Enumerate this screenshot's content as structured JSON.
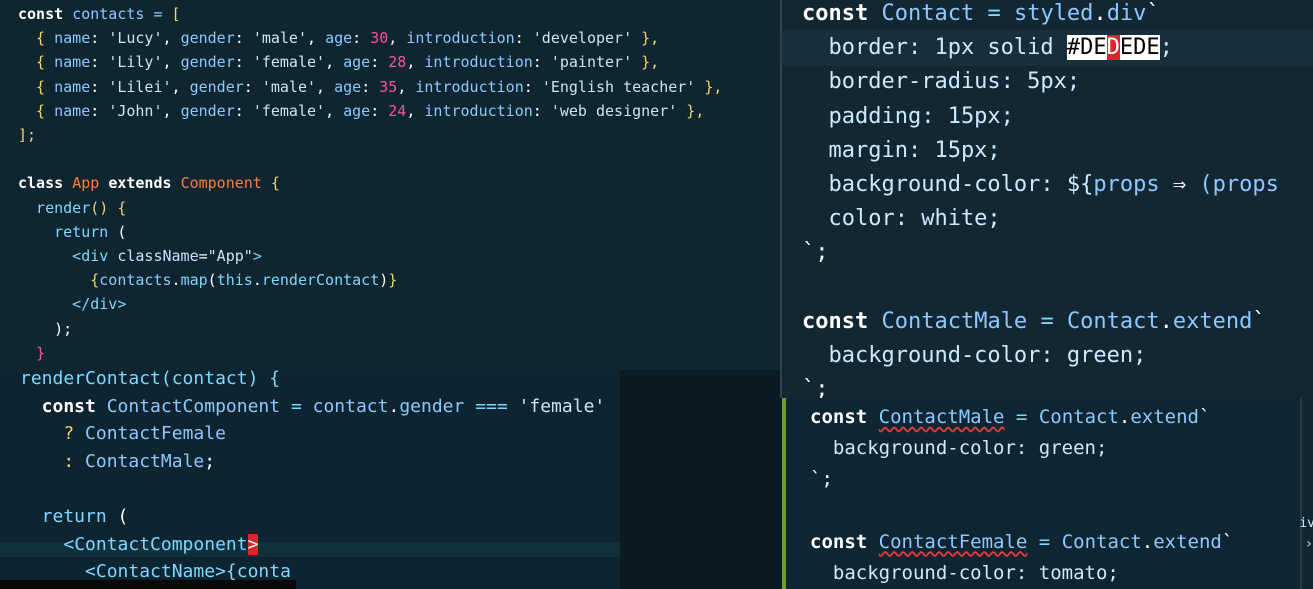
{
  "panel_a": {
    "lines": [
      [
        {
          "t": "const ",
          "c": "kw"
        },
        {
          "t": "contacts",
          "c": "ident"
        },
        {
          "t": " = ",
          "c": "op"
        },
        {
          "t": "[",
          "c": "punc"
        }
      ],
      [
        {
          "t": "  { ",
          "c": "punc"
        },
        {
          "t": "name",
          "c": "ident"
        },
        {
          "t": ": ",
          "c": "plain"
        },
        {
          "t": "'Lucy'",
          "c": "str"
        },
        {
          "t": ", ",
          "c": "plain"
        },
        {
          "t": "gender",
          "c": "ident"
        },
        {
          "t": ": ",
          "c": "plain"
        },
        {
          "t": "'male'",
          "c": "str"
        },
        {
          "t": ", ",
          "c": "plain"
        },
        {
          "t": "age",
          "c": "ident"
        },
        {
          "t": ": ",
          "c": "plain"
        },
        {
          "t": "30",
          "c": "num"
        },
        {
          "t": ", ",
          "c": "plain"
        },
        {
          "t": "introduction",
          "c": "ident"
        },
        {
          "t": ": ",
          "c": "plain"
        },
        {
          "t": "'developer'",
          "c": "str"
        },
        {
          "t": " },",
          "c": "punc"
        }
      ],
      [
        {
          "t": "  { ",
          "c": "punc"
        },
        {
          "t": "name",
          "c": "ident"
        },
        {
          "t": ": ",
          "c": "plain"
        },
        {
          "t": "'Lily'",
          "c": "str"
        },
        {
          "t": ", ",
          "c": "plain"
        },
        {
          "t": "gender",
          "c": "ident"
        },
        {
          "t": ": ",
          "c": "plain"
        },
        {
          "t": "'female'",
          "c": "str"
        },
        {
          "t": ", ",
          "c": "plain"
        },
        {
          "t": "age",
          "c": "ident"
        },
        {
          "t": ": ",
          "c": "plain"
        },
        {
          "t": "28",
          "c": "num"
        },
        {
          "t": ", ",
          "c": "plain"
        },
        {
          "t": "introduction",
          "c": "ident"
        },
        {
          "t": ": ",
          "c": "plain"
        },
        {
          "t": "'painter'",
          "c": "str"
        },
        {
          "t": " },",
          "c": "punc"
        }
      ],
      [
        {
          "t": "  { ",
          "c": "punc"
        },
        {
          "t": "name",
          "c": "ident"
        },
        {
          "t": ": ",
          "c": "plain"
        },
        {
          "t": "'Lilei'",
          "c": "str"
        },
        {
          "t": ", ",
          "c": "plain"
        },
        {
          "t": "gender",
          "c": "ident"
        },
        {
          "t": ": ",
          "c": "plain"
        },
        {
          "t": "'male'",
          "c": "str"
        },
        {
          "t": ", ",
          "c": "plain"
        },
        {
          "t": "age",
          "c": "ident"
        },
        {
          "t": ": ",
          "c": "plain"
        },
        {
          "t": "35",
          "c": "num"
        },
        {
          "t": ", ",
          "c": "plain"
        },
        {
          "t": "introduction",
          "c": "ident"
        },
        {
          "t": ": ",
          "c": "plain"
        },
        {
          "t": "'English teacher'",
          "c": "str"
        },
        {
          "t": " },",
          "c": "punc"
        }
      ],
      [
        {
          "t": "  { ",
          "c": "punc"
        },
        {
          "t": "name",
          "c": "ident"
        },
        {
          "t": ": ",
          "c": "plain"
        },
        {
          "t": "'John'",
          "c": "str"
        },
        {
          "t": ", ",
          "c": "plain"
        },
        {
          "t": "gender",
          "c": "ident"
        },
        {
          "t": ": ",
          "c": "plain"
        },
        {
          "t": "'female'",
          "c": "str"
        },
        {
          "t": ", ",
          "c": "plain"
        },
        {
          "t": "age",
          "c": "ident"
        },
        {
          "t": ": ",
          "c": "plain"
        },
        {
          "t": "24",
          "c": "num"
        },
        {
          "t": ", ",
          "c": "plain"
        },
        {
          "t": "introduction",
          "c": "ident"
        },
        {
          "t": ": ",
          "c": "plain"
        },
        {
          "t": "'web designer'",
          "c": "str"
        },
        {
          "t": " },",
          "c": "punc"
        }
      ],
      [
        {
          "t": "];",
          "c": "punc"
        }
      ],
      [],
      [
        {
          "t": "class ",
          "c": "kw"
        },
        {
          "t": "App ",
          "c": "cls"
        },
        {
          "t": "extends ",
          "c": "kw"
        },
        {
          "t": "Component ",
          "c": "cls"
        },
        {
          "t": "{",
          "c": "punc"
        }
      ],
      [
        {
          "t": "  render",
          "c": "ml"
        },
        {
          "t": "() ",
          "c": "punc"
        },
        {
          "t": "{",
          "c": "punc"
        }
      ],
      [
        {
          "t": "    return ",
          "c": "ml"
        },
        {
          "t": "(",
          "c": "plain"
        }
      ],
      [
        {
          "t": "      <",
          "c": "tag"
        },
        {
          "t": "div ",
          "c": "tag"
        },
        {
          "t": "className",
          "c": "attr"
        },
        {
          "t": "=",
          "c": "plain"
        },
        {
          "t": "\"App\"",
          "c": "str"
        },
        {
          "t": ">",
          "c": "tag"
        }
      ],
      [
        {
          "t": "        {",
          "c": "punc"
        },
        {
          "t": "contacts",
          "c": "ident"
        },
        {
          "t": ".",
          "c": "plain"
        },
        {
          "t": "map",
          "c": "ml"
        },
        {
          "t": "(",
          "c": "plain"
        },
        {
          "t": "this",
          "c": "ml"
        },
        {
          "t": ".",
          "c": "plain"
        },
        {
          "t": "renderContact",
          "c": "ml"
        },
        {
          "t": ")",
          "c": "plain"
        },
        {
          "t": "}",
          "c": "punc"
        }
      ],
      [
        {
          "t": "      </",
          "c": "tag"
        },
        {
          "t": "div",
          "c": "tag"
        },
        {
          "t": ">",
          "c": "tag"
        }
      ],
      [
        {
          "t": "    );",
          "c": "plain"
        }
      ],
      [
        {
          "t": "  }",
          "c": "num"
        }
      ]
    ]
  },
  "panel_b": {
    "lines": [
      [
        {
          "t": "const ",
          "c": "kw"
        },
        {
          "t": "Contact ",
          "c": "ident"
        },
        {
          "t": "= ",
          "c": "op"
        },
        {
          "t": "styled",
          "c": "ident"
        },
        {
          "t": ".",
          "c": "plain"
        },
        {
          "t": "div",
          "c": "ident"
        },
        {
          "t": "`",
          "c": "plain"
        }
      ],
      [
        {
          "t": "  border: 1px solid ",
          "c": "val"
        },
        {
          "t": "#DE",
          "c": "sel"
        },
        {
          "t": "D",
          "c": "sel-red"
        },
        {
          "t": "EDE",
          "c": "sel"
        },
        {
          "t": ";",
          "c": "val"
        }
      ],
      [
        {
          "t": "  border-radius: 5px;",
          "c": "val"
        }
      ],
      [
        {
          "t": "  padding: 15px;",
          "c": "val"
        }
      ],
      [
        {
          "t": "  margin: 15px;",
          "c": "val"
        }
      ],
      [
        {
          "t": "  background-color: ${",
          "c": "val"
        },
        {
          "t": "props ",
          "c": "ident"
        },
        {
          "t": "⇒ ",
          "c": "plain"
        },
        {
          "t": "(props",
          "c": "ident"
        }
      ],
      [
        {
          "t": "  color: white;",
          "c": "val"
        }
      ],
      [
        {
          "t": "`;",
          "c": "plain"
        }
      ],
      [],
      [
        {
          "t": "const ",
          "c": "kw"
        },
        {
          "t": "ContactMale ",
          "c": "ident"
        },
        {
          "t": "= ",
          "c": "op"
        },
        {
          "t": "Contact",
          "c": "ident"
        },
        {
          "t": ".",
          "c": "plain"
        },
        {
          "t": "extend",
          "c": "ident"
        },
        {
          "t": "`",
          "c": "plain"
        }
      ],
      [
        {
          "t": "  background-color: green;",
          "c": "val"
        }
      ],
      [
        {
          "t": "`;",
          "c": "plain"
        }
      ]
    ]
  },
  "panel_c": {
    "lines": [
      [
        {
          "t": "renderContact(contact) {",
          "c": "ml"
        }
      ],
      [
        {
          "t": "  const ",
          "c": "kw"
        },
        {
          "t": "ContactComponent ",
          "c": "ident"
        },
        {
          "t": "= ",
          "c": "op"
        },
        {
          "t": "contact",
          "c": "ident"
        },
        {
          "t": ".",
          "c": "plain"
        },
        {
          "t": "gender ",
          "c": "ident"
        },
        {
          "t": "=== ",
          "c": "op"
        },
        {
          "t": "'female'",
          "c": "str"
        }
      ],
      [
        {
          "t": "    ? ",
          "c": "punc"
        },
        {
          "t": "ContactFemale",
          "c": "ident"
        }
      ],
      [
        {
          "t": "    : ",
          "c": "punc"
        },
        {
          "t": "ContactMale",
          "c": "ident"
        },
        {
          "t": ";",
          "c": "plain"
        }
      ],
      [],
      [
        {
          "t": "  return ",
          "c": "ml"
        },
        {
          "t": "(",
          "c": "plain"
        }
      ],
      [
        {
          "t": "    <",
          "c": "tag"
        },
        {
          "t": "ContactComponent",
          "c": "tag"
        },
        {
          "t": ">",
          "c": "sel-red"
        }
      ],
      [
        {
          "t": "      <ContactName>{conta",
          "c": "tag"
        }
      ]
    ]
  },
  "panel_d": {
    "lines": [
      [
        {
          "t": "const ",
          "c": "kw"
        },
        {
          "t": "ContactMale",
          "c": "ident squig"
        },
        {
          "t": " = ",
          "c": "op"
        },
        {
          "t": "Contact",
          "c": "ident"
        },
        {
          "t": ".",
          "c": "plain"
        },
        {
          "t": "extend",
          "c": "ident"
        },
        {
          "t": "`",
          "c": "plain"
        }
      ],
      [
        {
          "t": "  background-color: green;",
          "c": "val"
        }
      ],
      [
        {
          "t": "`;",
          "c": "plain"
        }
      ],
      [],
      [
        {
          "t": "const ",
          "c": "kw"
        },
        {
          "t": "ContactFemale",
          "c": "ident squig"
        },
        {
          "t": " = ",
          "c": "op"
        },
        {
          "t": "Contact",
          "c": "ident"
        },
        {
          "t": ".",
          "c": "plain"
        },
        {
          "t": "extend",
          "c": "ident"
        },
        {
          "t": "`",
          "c": "plain"
        }
      ],
      [
        {
          "t": "  background-color: tomato;",
          "c": "val"
        }
      ]
    ],
    "side_fragment": "iv"
  }
}
